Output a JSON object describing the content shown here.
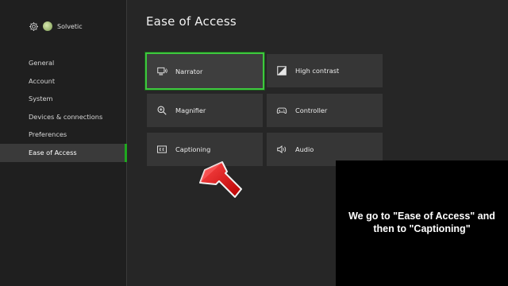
{
  "profile": {
    "gamertag": "Solvetic"
  },
  "sidebar": {
    "items": [
      {
        "label": "General"
      },
      {
        "label": "Account"
      },
      {
        "label": "System"
      },
      {
        "label": "Devices & connections"
      },
      {
        "label": "Preferences"
      },
      {
        "label": "Ease of Access",
        "selected": true
      }
    ]
  },
  "main": {
    "title": "Ease of Access",
    "tiles": [
      {
        "label": "Narrator",
        "icon": "narrator-icon",
        "focused": true
      },
      {
        "label": "High contrast",
        "icon": "high-contrast-icon"
      },
      {
        "label": "Magnifier",
        "icon": "magnifier-icon"
      },
      {
        "label": "Controller",
        "icon": "controller-icon"
      },
      {
        "label": "Captioning",
        "icon": "captioning-icon"
      },
      {
        "label": "Audio",
        "icon": "audio-icon"
      }
    ]
  },
  "overlay": {
    "text": "We go to \"Ease of Access\" and then to \"Captioning\""
  },
  "colors": {
    "accent": "#3ec83e",
    "arrow": "#e01010"
  }
}
